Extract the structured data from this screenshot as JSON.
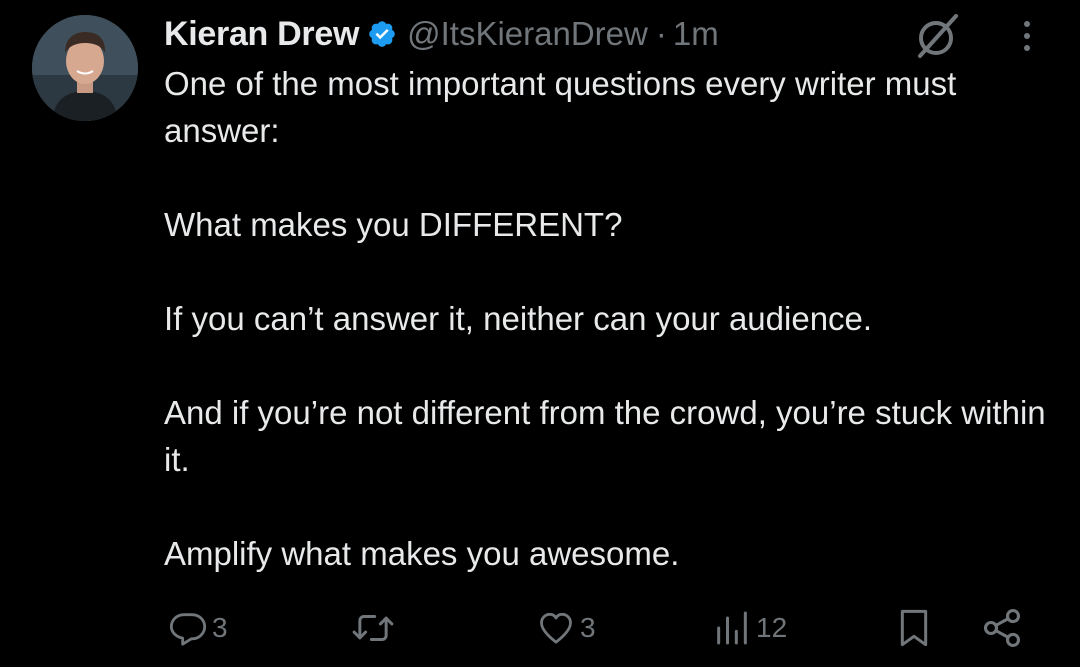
{
  "tweet": {
    "author_name": "Kieran Drew",
    "handle": "@ItsKieranDrew",
    "separator": "·",
    "time": "1m",
    "paragraphs": [
      "One of the most important questions every writer must answer:",
      "What makes you DIFFERENT?",
      "If you can’t answer it, neither can your audience.",
      "And if you’re not different from the crowd, you’re stuck within it.",
      "Amplify what makes you awesome."
    ],
    "replies": "3",
    "likes": "3",
    "views": "12"
  },
  "icons": {
    "verified": "verified-badge-icon",
    "grok": "grok-icon",
    "more": "more-vertical-icon",
    "reply": "reply-icon",
    "retweet": "retweet-icon",
    "like": "heart-icon",
    "views": "views-icon",
    "bookmark": "bookmark-icon",
    "share": "share-icon"
  },
  "colors": {
    "background": "#000000",
    "text": "#e7e9ea",
    "secondary": "#71767b",
    "verified": "#1d9bf0"
  }
}
